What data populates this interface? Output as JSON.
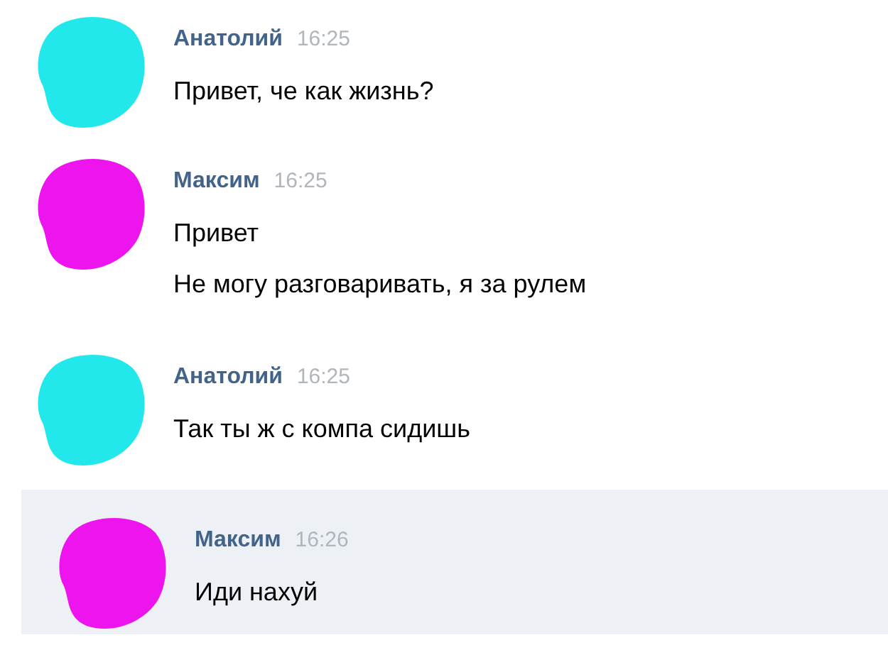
{
  "messages": [
    {
      "author": "Анатолий",
      "time": "16:25",
      "color": "#22e8ec",
      "selected": false,
      "lines": [
        "Привет, че как жизнь?"
      ]
    },
    {
      "author": "Максим",
      "time": "16:25",
      "color": "#ee14ee",
      "selected": false,
      "lines": [
        "Привет",
        "Не могу разговаривать, я за рулем"
      ]
    },
    {
      "author": "Анатолий",
      "time": "16:25",
      "color": "#22e8ec",
      "selected": false,
      "lines": [
        "Так ты ж с компа сидишь"
      ]
    },
    {
      "author": "Максим",
      "time": "16:26",
      "color": "#ee14ee",
      "selected": true,
      "lines": [
        "Иди нахуй"
      ]
    }
  ]
}
